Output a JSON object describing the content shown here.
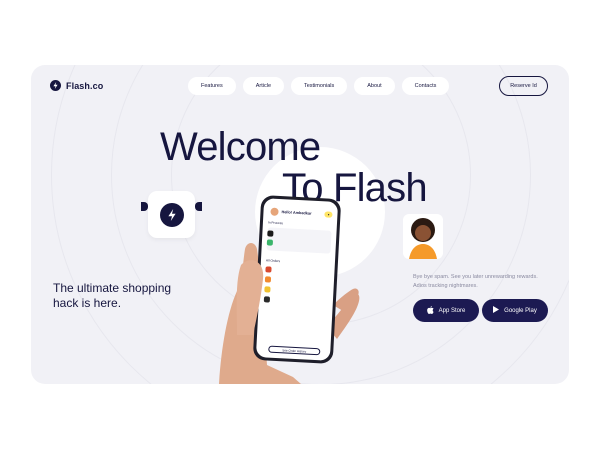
{
  "brand": {
    "name": "Flash.co"
  },
  "nav": {
    "items": [
      "Features",
      "Article",
      "Testimonials",
      "About",
      "Contacts"
    ]
  },
  "header": {
    "reserve_label": "Reserve Id"
  },
  "hero": {
    "title_line1": "Welcome",
    "title_line2": "To Flash",
    "tagline": "The ultimate shopping hack is here.",
    "blurb": "Bye bye spam. See you later unrewarding rewards. Adios tracking nightmares."
  },
  "store_buttons": {
    "app_store": "App Store",
    "google_play": "Google Play"
  },
  "phone": {
    "greeting": "Hello! Ambedkar",
    "section_in_process": "In Process",
    "section_all_orders": "All Orders",
    "view_button": "See Order History"
  },
  "colors": {
    "navy": "#16163f",
    "button": "#1c1a52",
    "background": "#f1f1f6",
    "accent": "#ffe566",
    "avatar_shirt": "#f59a2a"
  },
  "icons": [
    "flash-logo-icon",
    "apple-icon",
    "play-icon"
  ]
}
